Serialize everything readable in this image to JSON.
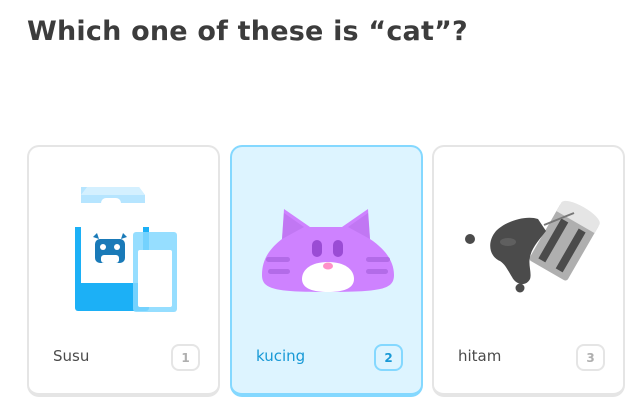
{
  "prompt": {
    "title": "Which one of these is “cat”?"
  },
  "choices": [
    {
      "label": "Susu",
      "key": "1",
      "icon": "milk-icon",
      "selected": false
    },
    {
      "label": "kucing",
      "key": "2",
      "icon": "cat-icon",
      "selected": true
    },
    {
      "label": "hitam",
      "key": "3",
      "icon": "black-paint-icon",
      "selected": false
    }
  ],
  "colors": {
    "text": "#3c3c3c",
    "selected_bg": "#ddf4ff",
    "selected_border": "#84d8ff",
    "selected_text": "#1899d6",
    "card_border": "#e5e5e5",
    "key_text": "#afafaf"
  }
}
